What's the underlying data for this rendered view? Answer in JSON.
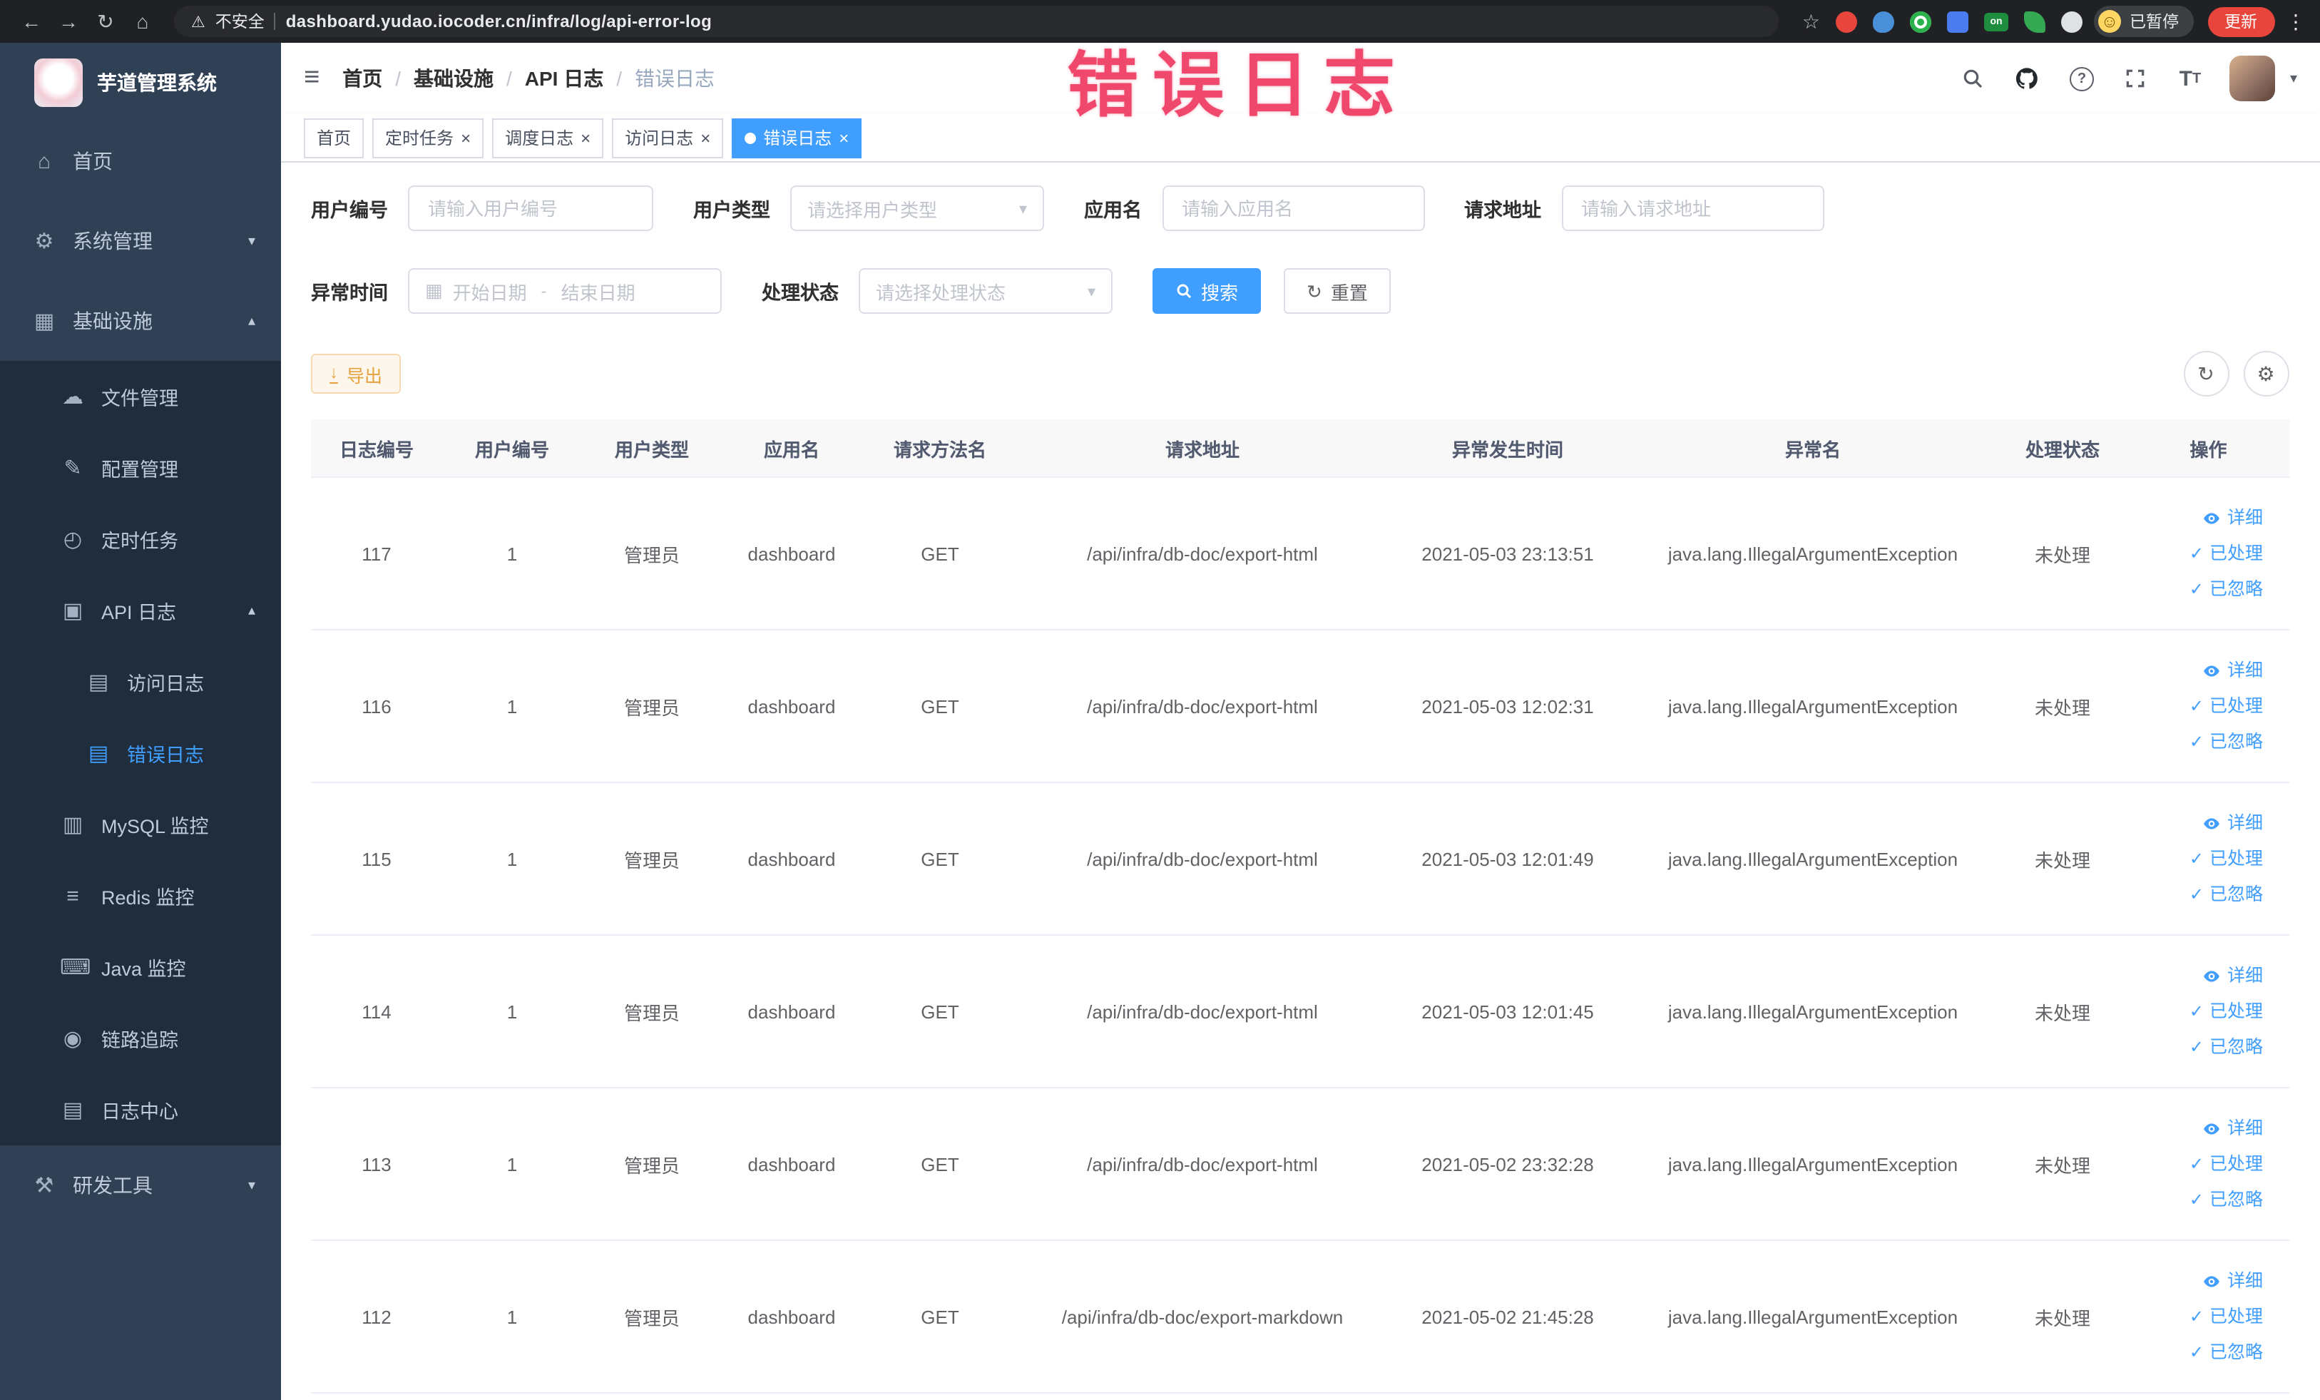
{
  "browser": {
    "security_label": "不安全",
    "url": "dashboard.yudao.iocoder.cn/infra/log/api-error-log",
    "paused_label": "已暂停",
    "update_label": "更新",
    "on_badge": "on"
  },
  "annotation": {
    "text": "错误日志"
  },
  "glyphs": {
    "home": "⌂",
    "gear": "⚙",
    "infrastructure": "▦",
    "file": "☁",
    "config": "✎",
    "timer": "◴",
    "api_log": "▣",
    "doc": "▤",
    "database": "▥",
    "layers": "≡",
    "monitor": "⌨",
    "trace": "◉",
    "log_center": "▤",
    "tools": "⚒",
    "chevron_down": "▾",
    "chevron_up": "▴",
    "hamburger": "≡",
    "caret": "▾",
    "refresh": "↻",
    "check": "✓",
    "calendar": "▦",
    "download": "↓",
    "back": "←",
    "forward": "→",
    "reload": "↻",
    "home_chrome": "⌂",
    "star": "☆",
    "warning": "⚠",
    "kebab": "⋮",
    "close": "×",
    "smiley": "☺",
    "range_sep": "-",
    "help": "?"
  },
  "sidebar": {
    "title": "芋道管理系统",
    "items": [
      {
        "label": "首页",
        "icon": "home-icon"
      },
      {
        "label": "系统管理",
        "icon": "gear-icon"
      },
      {
        "label": "基础设施",
        "icon": "infrastructure-icon"
      },
      {
        "label": "文件管理",
        "icon": "file-icon"
      },
      {
        "label": "配置管理",
        "icon": "config-icon"
      },
      {
        "label": "定时任务",
        "icon": "timer-icon"
      },
      {
        "label": "API 日志",
        "icon": "api-log-icon"
      },
      {
        "label": "访问日志",
        "icon": "doc-icon"
      },
      {
        "label": "错误日志",
        "icon": "doc-icon",
        "active": true
      },
      {
        "label": "MySQL 监控",
        "icon": "database-icon"
      },
      {
        "label": "Redis 监控",
        "icon": "layers-icon"
      },
      {
        "label": "Java 监控",
        "icon": "monitor-icon"
      },
      {
        "label": "链路追踪",
        "icon": "trace-icon"
      },
      {
        "label": "日志中心",
        "icon": "doc-icon"
      },
      {
        "label": "研发工具",
        "icon": "tools-icon"
      }
    ]
  },
  "breadcrumb": {
    "separator": "/",
    "items": [
      "首页",
      "基础设施",
      "API 日志",
      "错误日志"
    ]
  },
  "tags": [
    {
      "label": "首页",
      "closable": false,
      "active": false
    },
    {
      "label": "定时任务",
      "closable": true,
      "active": false
    },
    {
      "label": "调度日志",
      "closable": true,
      "active": false
    },
    {
      "label": "访问日志",
      "closable": true,
      "active": false
    },
    {
      "label": "错误日志",
      "closable": true,
      "active": true
    }
  ],
  "filters": {
    "user_id": {
      "label": "用户编号",
      "placeholder": "请输入用户编号"
    },
    "user_type": {
      "label": "用户类型",
      "placeholder": "请选择用户类型"
    },
    "app_name": {
      "label": "应用名",
      "placeholder": "请输入应用名"
    },
    "request_url": {
      "label": "请求地址",
      "placeholder": "请输入请求地址"
    },
    "exception_time": {
      "label": "异常时间",
      "start_placeholder": "开始日期",
      "end_placeholder": "结束日期"
    },
    "process_status": {
      "label": "处理状态",
      "placeholder": "请选择处理状态"
    },
    "search_label": "搜索",
    "reset_label": "重置"
  },
  "toolbar": {
    "export_label": "导出"
  },
  "table": {
    "columns": [
      "日志编号",
      "用户编号",
      "用户类型",
      "应用名",
      "请求方法名",
      "请求地址",
      "异常发生时间",
      "异常名",
      "处理状态",
      "操作"
    ],
    "actions": [
      "详细",
      "已处理",
      "已忽略"
    ],
    "rows": [
      {
        "id": "117",
        "user_id": "1",
        "user_type": "管理员",
        "app": "dashboard",
        "method": "GET",
        "url": "/api/infra/db-doc/export-html",
        "time": "2021-05-03 23:13:51",
        "exception": "java.lang.IllegalArgumentException",
        "status": "未处理"
      },
      {
        "id": "116",
        "user_id": "1",
        "user_type": "管理员",
        "app": "dashboard",
        "method": "GET",
        "url": "/api/infra/db-doc/export-html",
        "time": "2021-05-03 12:02:31",
        "exception": "java.lang.IllegalArgumentException",
        "status": "未处理"
      },
      {
        "id": "115",
        "user_id": "1",
        "user_type": "管理员",
        "app": "dashboard",
        "method": "GET",
        "url": "/api/infra/db-doc/export-html",
        "time": "2021-05-03 12:01:49",
        "exception": "java.lang.IllegalArgumentException",
        "status": "未处理"
      },
      {
        "id": "114",
        "user_id": "1",
        "user_type": "管理员",
        "app": "dashboard",
        "method": "GET",
        "url": "/api/infra/db-doc/export-html",
        "time": "2021-05-03 12:01:45",
        "exception": "java.lang.IllegalArgumentException",
        "status": "未处理"
      },
      {
        "id": "113",
        "user_id": "1",
        "user_type": "管理员",
        "app": "dashboard",
        "method": "GET",
        "url": "/api/infra/db-doc/export-html",
        "time": "2021-05-02 23:32:28",
        "exception": "java.lang.IllegalArgumentException",
        "status": "未处理"
      },
      {
        "id": "112",
        "user_id": "1",
        "user_type": "管理员",
        "app": "dashboard",
        "method": "GET",
        "url": "/api/infra/db-doc/export-markdown",
        "time": "2021-05-02 21:45:28",
        "exception": "java.lang.IllegalArgumentException",
        "status": "未处理"
      }
    ]
  },
  "colors": {
    "accent": "#409eff",
    "sidebar_bg": "#304156",
    "sidebar_submenu_bg": "#1f2d3d",
    "tag_active_bg": "#409eff",
    "warning_text": "#e6a23c",
    "annotation": "#f0476c",
    "chrome_bg": "#202124",
    "update_button_bg": "#e8453c",
    "table_header_bg": "#f8f8f9"
  }
}
